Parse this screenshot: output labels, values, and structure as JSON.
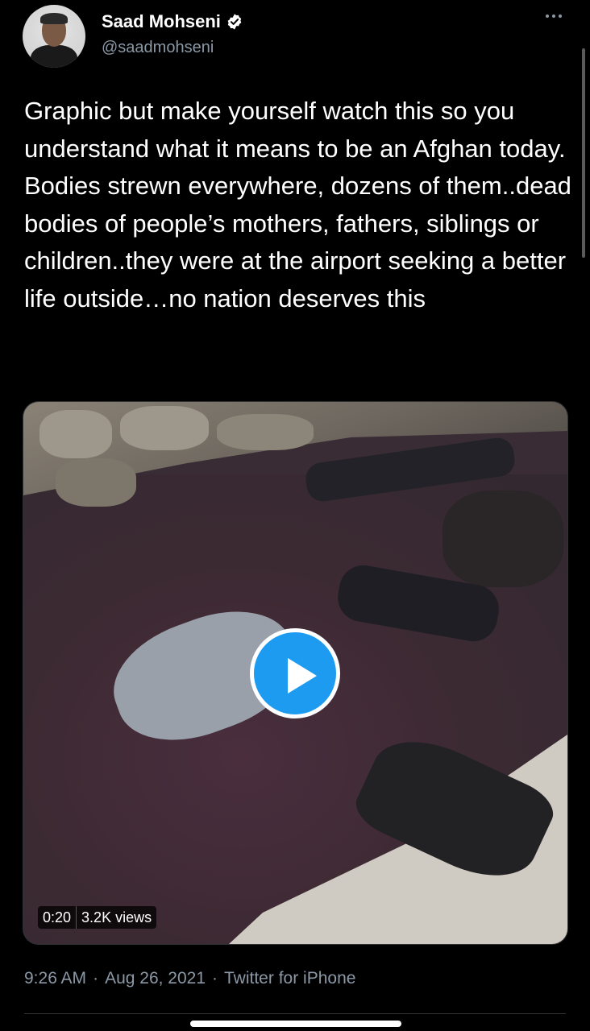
{
  "author": {
    "name": "Saad Mohseni",
    "handle": "@saadmohseni",
    "verified_icon": "verified-badge-icon",
    "avatar_icon": "avatar"
  },
  "tweet": {
    "text": "Graphic but make yourself watch this so you understand what it means to be an Afghan today. Bodies strewn everywhere, dozens of them..dead bodies of people’s mothers, fathers, siblings or children..they were at the airport seeking a better life outside…no nation deserves this"
  },
  "media": {
    "type": "video",
    "duration": "0:20",
    "views": "3.2K views",
    "play_icon": "play-icon"
  },
  "meta": {
    "time": "9:26 AM",
    "separator": "·",
    "date": "Aug 26, 2021",
    "source": "Twitter for iPhone"
  },
  "colors": {
    "background": "#000000",
    "text": "#ffffff",
    "secondary": "#8b98a5",
    "accent": "#1d9bf0"
  }
}
